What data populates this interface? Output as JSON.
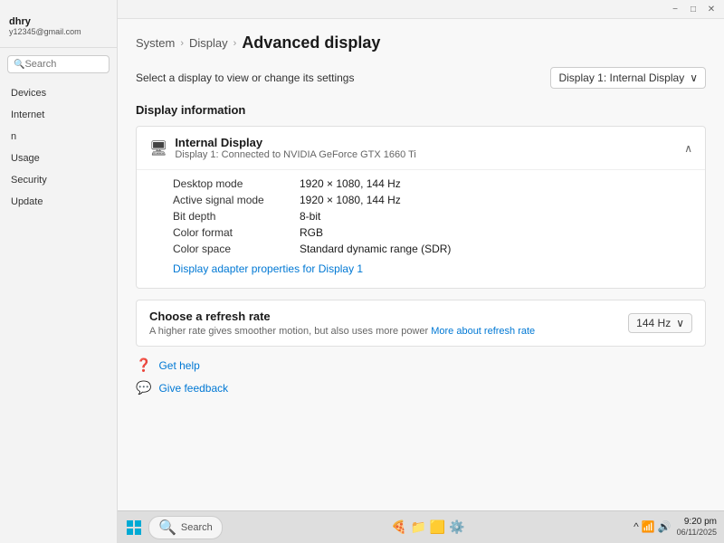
{
  "window": {
    "title_buttons": {
      "minimize": "−",
      "maximize": "□",
      "close": "✕"
    }
  },
  "sidebar": {
    "user": {
      "name": "dhry",
      "email": "y12345@gmail.com"
    },
    "search_placeholder": "Search",
    "items": [
      {
        "id": "devices",
        "label": "Devices"
      },
      {
        "id": "internet",
        "label": "Internet"
      },
      {
        "id": "n",
        "label": "n"
      },
      {
        "id": "usage",
        "label": "Usage"
      },
      {
        "id": "security",
        "label": "Security"
      },
      {
        "id": "update",
        "label": "Update"
      }
    ]
  },
  "breadcrumb": {
    "parts": [
      "System",
      "Display"
    ],
    "current": "Advanced display"
  },
  "select_display": {
    "label": "Select a display to view or change its settings",
    "dropdown_value": "Display 1: Internal Display",
    "dropdown_arrow": "∨"
  },
  "display_information": {
    "section_title": "Display information",
    "card": {
      "name": "Internal Display",
      "subtitle": "Display 1: Connected to NVIDIA GeForce GTX 1660 Ti",
      "chevron": "∧",
      "fields": [
        {
          "label": "Desktop mode",
          "value": "1920 × 1080, 144 Hz"
        },
        {
          "label": "Active signal mode",
          "value": "1920 × 1080, 144 Hz"
        },
        {
          "label": "Bit depth",
          "value": "8-bit"
        },
        {
          "label": "Color format",
          "value": "RGB"
        },
        {
          "label": "Color space",
          "value": "Standard dynamic range (SDR)"
        }
      ],
      "adapter_link": "Display adapter properties for Display 1"
    }
  },
  "refresh_rate": {
    "title": "Choose a refresh rate",
    "description": "A higher rate gives smoother motion, but also uses more power",
    "more_link": "More about refresh rate",
    "value": "144 Hz",
    "dropdown_arrow": "∨"
  },
  "help": {
    "items": [
      {
        "id": "get-help",
        "icon": "❓",
        "label": "Get help"
      },
      {
        "id": "give-feedback",
        "icon": "💬",
        "label": "Give feedback"
      }
    ]
  },
  "taskbar": {
    "search_placeholder": "Search",
    "clock": {
      "time": "9:20 pm",
      "date": "06/11/2025"
    },
    "tray_icons": [
      "^",
      "🔊",
      "📶"
    ]
  }
}
